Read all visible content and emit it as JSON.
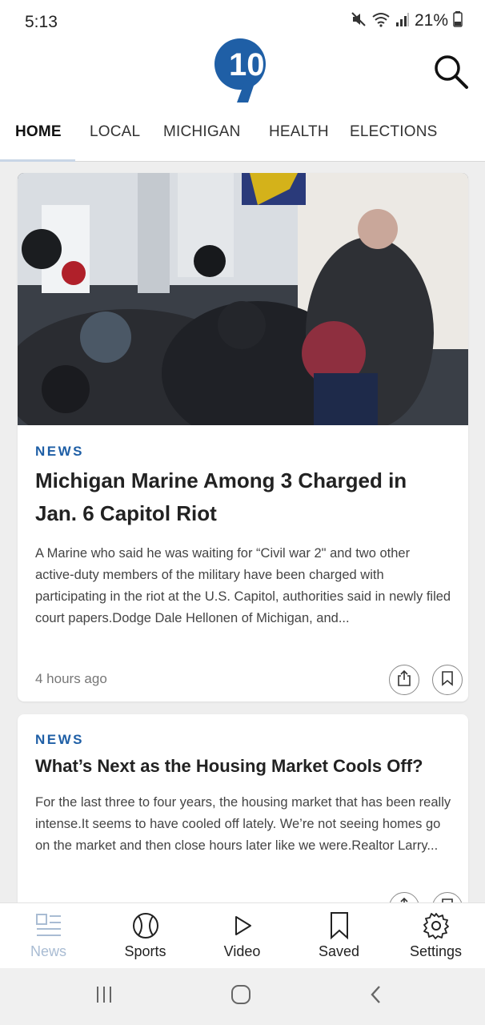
{
  "status": {
    "time": "5:13",
    "battery": "21%"
  },
  "tabs": [
    {
      "label": "HOME",
      "active": true
    },
    {
      "label": "LOCAL"
    },
    {
      "label": "MICHIGAN"
    },
    {
      "label": "HEALTH"
    },
    {
      "label": "ELECTIONS"
    }
  ],
  "articles": [
    {
      "category": "NEWS",
      "headline": "Michigan Marine Among 3 Charged in Jan. 6 Capitol Riot",
      "summary": "A Marine who said he was waiting for “Civil war 2\" and two other active-duty members of the military have been charged with participating in the riot at the U.S. Capitol, authorities said in newly filed court papers.Dodge Dale Hellonen of Michigan, and...",
      "time": "4 hours ago"
    },
    {
      "category": "NEWS",
      "headline": "What’s Next as the Housing Market Cools Off?",
      "summary": "For the last three to four years, the housing market that has been really intense.It seems to have cooled off lately. We’re not seeing homes go on the market and then close hours later like we were.Realtor Larry..."
    }
  ],
  "bottom_nav": [
    {
      "label": "News",
      "icon": "news-icon",
      "active": true
    },
    {
      "label": "Sports",
      "icon": "sports-ball-icon"
    },
    {
      "label": "Video",
      "icon": "play-icon"
    },
    {
      "label": "Saved",
      "icon": "bookmark-icon"
    },
    {
      "label": "Settings",
      "icon": "gear-icon"
    }
  ],
  "colors": {
    "brand_blue": "#1f5fa6",
    "active_nav": "#a9bcd3"
  }
}
